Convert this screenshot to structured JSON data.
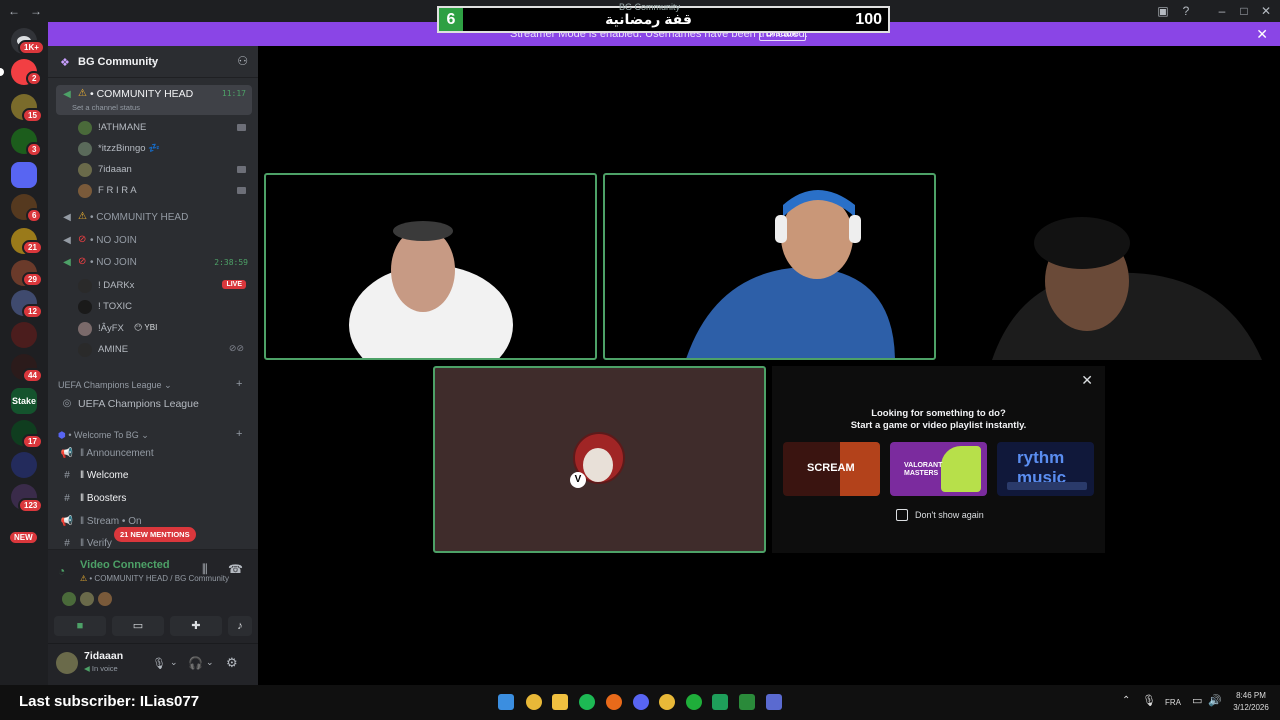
{
  "overlay": {
    "left_number": "6",
    "title": "قفة رمضانية",
    "right_number": "100",
    "small_title": "BG Community"
  },
  "banner": {
    "text": "Streamer Mode is enabled. Usernames have been truncated.",
    "button": "Disable"
  },
  "rail_badges": [
    "1K+",
    "2",
    "15",
    "3",
    "6",
    "21",
    "29",
    "12",
    "44",
    "17",
    "123",
    "NEW"
  ],
  "guild": {
    "name": "BG Community"
  },
  "channels": {
    "community_head_active": {
      "name": "• COMMUNITY HEAD",
      "status": "Set a channel status",
      "time": "11:17"
    },
    "users_active": [
      "!ATHMANE",
      "*itzzBinngo 💤",
      "7idaaan",
      "F R I R A"
    ],
    "community_head_2": "• COMMUNITY HEAD",
    "no_join_1": "• NO JOIN",
    "no_join_2": {
      "name": "• NO JOIN",
      "time": "2:38:59"
    },
    "users_nojoin": [
      "! DARKx",
      "! TOXIC",
      "!ÂyFX",
      "AMINE"
    ],
    "live_badge": "LIVE",
    "ybi_tag": "YBI",
    "uefa_category": "UEFA Champions League",
    "uefa_channel": "UEFA Champions League",
    "welcome_category": "• Welcome To BG",
    "text_channels": [
      "ǁ Announcement",
      "ǁ Welcome",
      "ǁ Boosters",
      "ǁ Stream • On",
      "ǁ Verify"
    ],
    "mentions": "21 NEW MENTIONS"
  },
  "voice": {
    "status": "Video Connected",
    "location": "• COMMUNITY HEAD / BG Community"
  },
  "user_panel": {
    "name": "7idaaan",
    "status": "In voice"
  },
  "activity": {
    "title": "Looking for something to do?",
    "subtitle": "Start a game or video playlist instantly.",
    "cards": [
      "SCREAM",
      "VALORANT MASTERS",
      "rythm music"
    ],
    "checkbox": "Don't show again"
  },
  "taskbar": {
    "last_subscriber": "Last subscriber: ILias077",
    "lang": "FRA",
    "time": "8:46 PM",
    "date": "3/12/2026"
  },
  "colors": {
    "accent": "#4da167",
    "banner": "#8a45e6",
    "live": "#da373c"
  }
}
